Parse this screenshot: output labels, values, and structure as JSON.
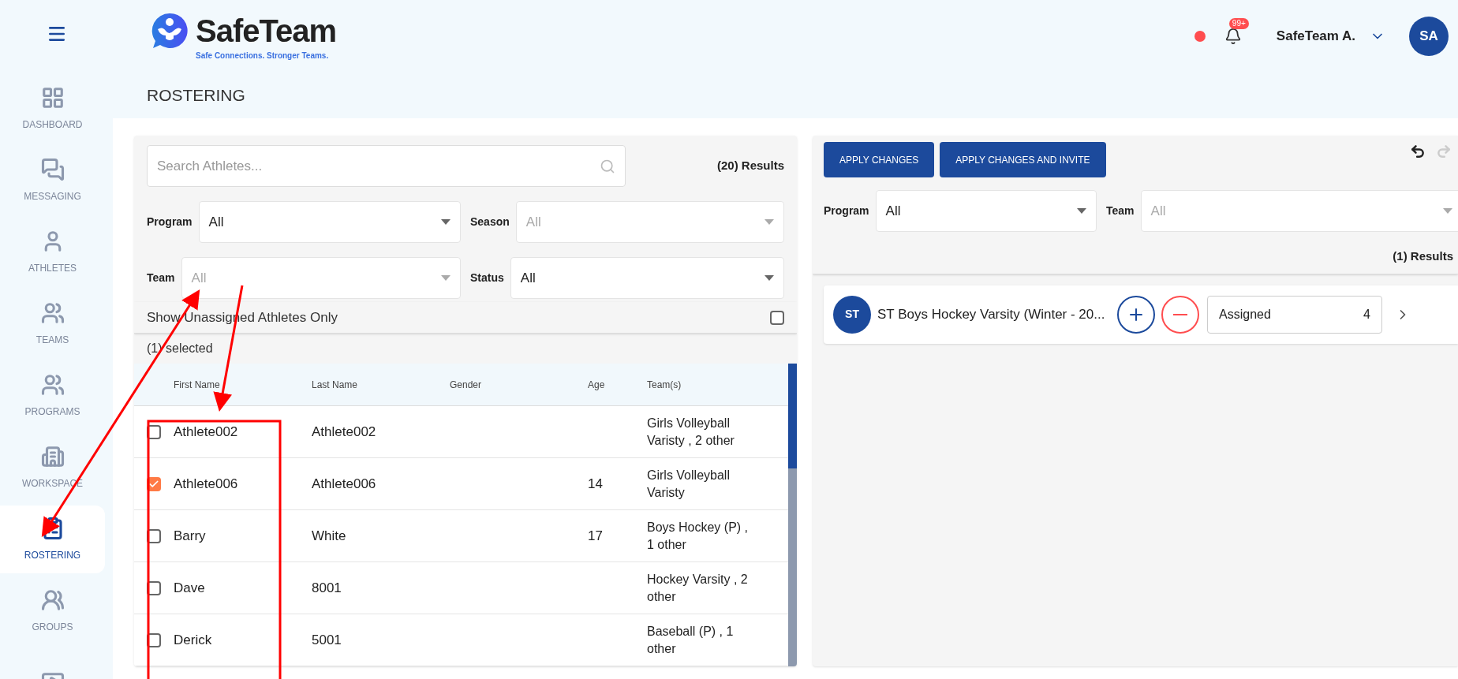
{
  "header": {
    "brand": "SafeTeam",
    "tagline": "Safe Connections. Stronger Teams.",
    "notification_badge": "99+",
    "user_name": "SafeTeam A.",
    "avatar_initials": "SA"
  },
  "page_title": "ROSTERING",
  "sidebar": {
    "items": [
      {
        "kind": "labeled",
        "label": "DASHBOARD",
        "selected": false
      },
      {
        "kind": "labeled",
        "label": "MESSAGING",
        "selected": false
      },
      {
        "kind": "labeled",
        "label": "ATHLETES",
        "selected": false
      },
      {
        "kind": "labeled",
        "label": "TEAMS",
        "selected": false
      },
      {
        "kind": "labeled",
        "label": "PROGRAMS",
        "selected": false
      },
      {
        "kind": "labeled",
        "label": "WORKSPACE",
        "selected": false
      },
      {
        "kind": "labeled",
        "label": "ROSTERING",
        "selected": true
      },
      {
        "kind": "labeled",
        "label": "GROUPS",
        "selected": false
      },
      {
        "kind": "icon_only",
        "selected": false
      }
    ]
  },
  "left_panel": {
    "search": {
      "placeholder": "Search Athletes..."
    },
    "results": "(20) Results",
    "filters": [
      {
        "label": "Program",
        "value": "All"
      },
      {
        "label": "Season",
        "placeholder": "All"
      },
      {
        "label": "Team",
        "placeholder": "All"
      },
      {
        "label": "Status",
        "value": "All"
      }
    ],
    "unassigned_only": {
      "label": "Show Unassigned Athletes Only",
      "checked": false
    },
    "selected_count": "(1) selected",
    "table": {
      "columns": [
        "First Name",
        "Last Name",
        "Gender",
        "Age",
        "Team(s)"
      ],
      "rows": [
        {
          "checked": false,
          "first_name": "Athlete002",
          "last_name": "Athlete002",
          "teams": "Girls Volleyball Varisty , 2 other"
        },
        {
          "checked": true,
          "first_name": "Athlete006",
          "last_name": "Athlete006",
          "age": "14",
          "teams": "Girls Volleyball Varisty"
        },
        {
          "checked": false,
          "first_name": "Barry",
          "last_name": "White",
          "age": "17",
          "teams": "Boys Hockey (P) , 1 other"
        },
        {
          "checked": false,
          "first_name": "Dave",
          "last_name": "8001",
          "teams": "Hockey Varsity , 2 other"
        },
        {
          "checked": false,
          "first_name": "Derick",
          "last_name": "5001",
          "teams": "Baseball (P) , 1 other"
        }
      ]
    }
  },
  "right_panel": {
    "buttons": [
      "APPLY CHANGES",
      "APPLY CHANGES AND INVITE"
    ],
    "filters": [
      {
        "label": "Program",
        "value": "All"
      },
      {
        "label": "Team",
        "placeholder": "All"
      }
    ],
    "results": "(1) Results",
    "teams": [
      {
        "initials": "ST",
        "name": "ST Boys Hockey Varsity (Winter - 20...",
        "status": "Assigned",
        "count": "4"
      }
    ]
  }
}
